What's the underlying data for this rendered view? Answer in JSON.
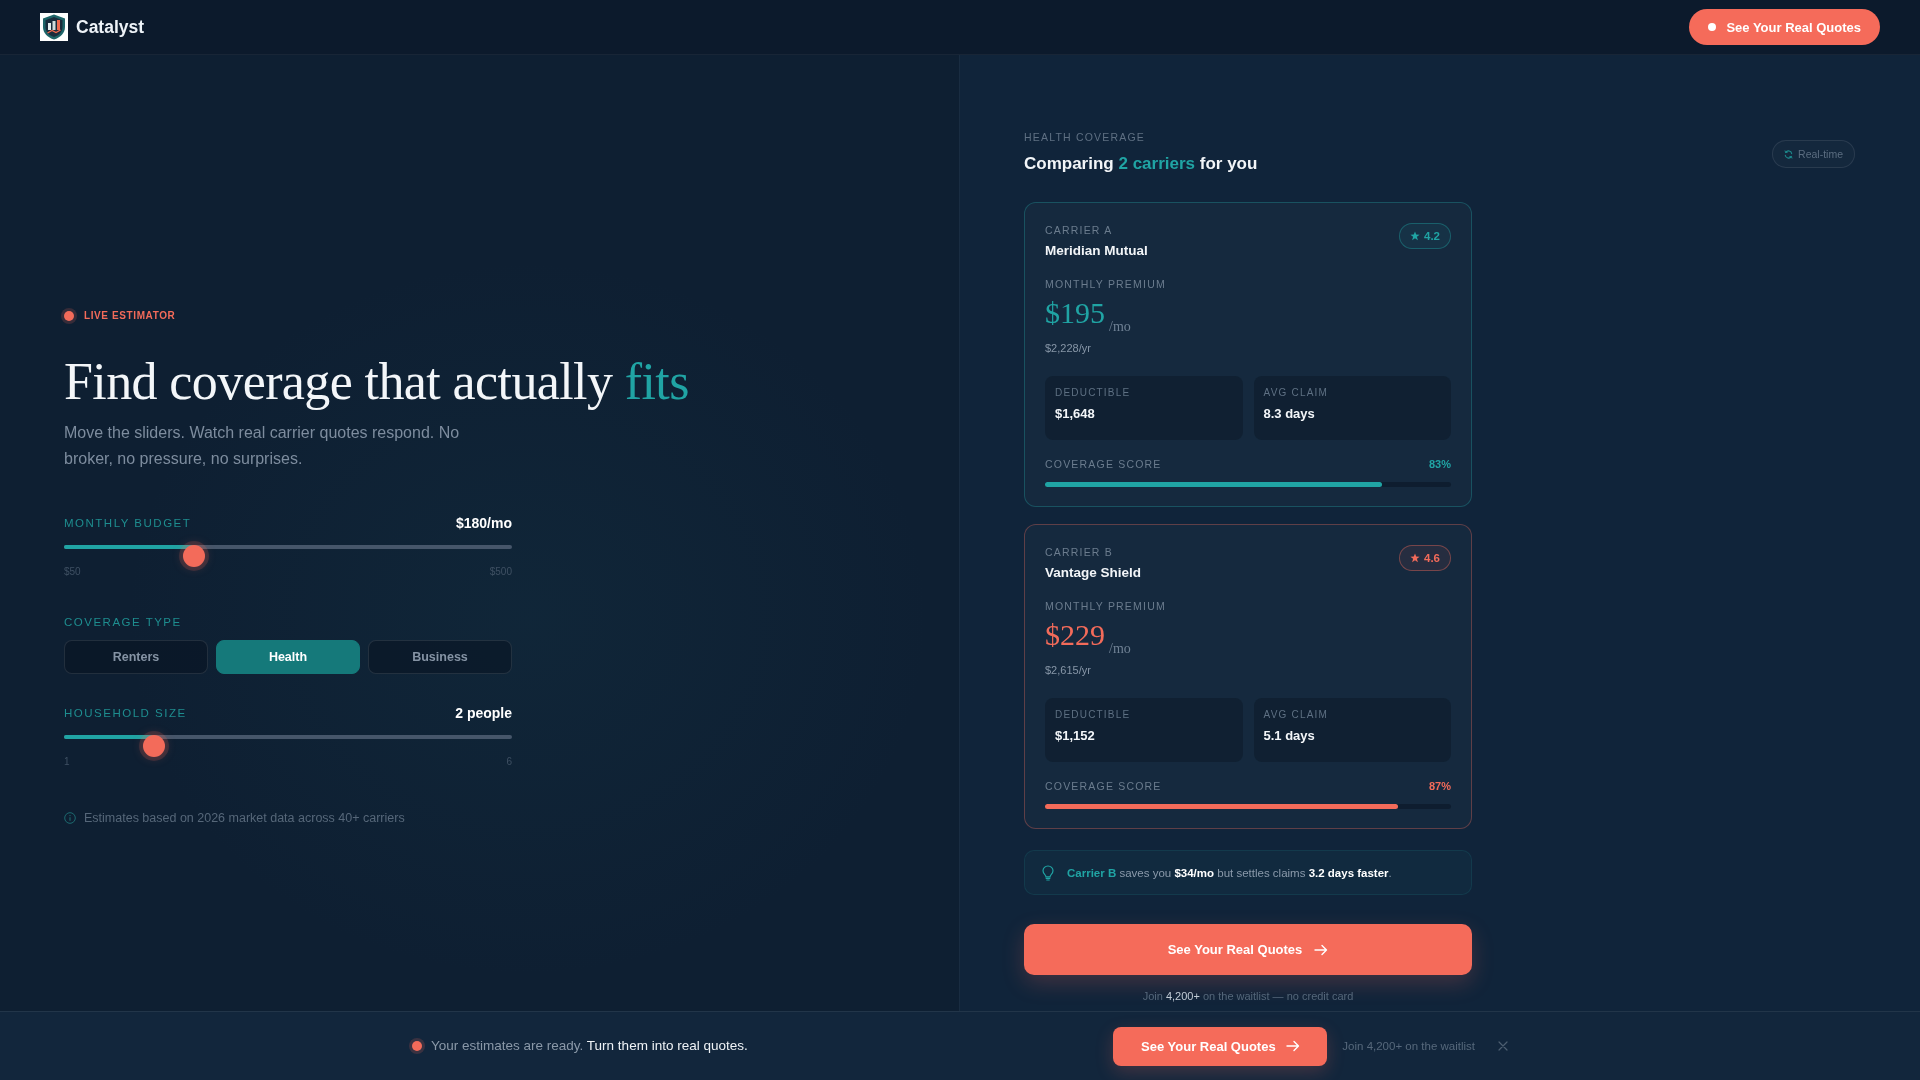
{
  "header": {
    "brand": "Catalyst",
    "cta": "See Your Real Quotes"
  },
  "estimator": {
    "eyebrow": "LIVE ESTIMATOR",
    "title": "Find coverage that actually",
    "title_accent": "fits",
    "subtitle": "Move the sliders. Watch real carrier quotes respond. No broker, no pressure, no surprises.",
    "controls": [
      {
        "kind": "slider",
        "label": "MONTHLY BUDGET",
        "value": "$180/mo",
        "level": 0.29,
        "min": "$50",
        "max": "$500"
      },
      {
        "kind": "choice",
        "label": "COVERAGE TYPE",
        "options": [
          {
            "label": "Renters",
            "selected": false
          },
          {
            "label": "Health",
            "selected": true
          },
          {
            "label": "Business",
            "selected": false
          }
        ]
      },
      {
        "kind": "slider",
        "label": "HOUSEHOLD SIZE",
        "value": "2 people",
        "level": 0.2,
        "min": "1",
        "max": "6"
      }
    ],
    "note": "Estimates based on 2026 market data across 40+ carriers"
  },
  "comparison": {
    "eyebrow": "HEALTH COVERAGE",
    "heading": {
      "lead": "Comparing",
      "accent": "2 carriers",
      "tail": "for you"
    },
    "badge": "Real-time",
    "carriers": [
      {
        "tag": "CARRIER A",
        "name": "Meridian Mutual",
        "rating": "4.2",
        "color": "#20a4a4",
        "premium_label": "MONTHLY PREMIUM",
        "price": "$195",
        "unit": "/mo",
        "yearly": "$2,228/yr",
        "stats": [
          {
            "label": "DEDUCTIBLE",
            "value": "$1,648"
          },
          {
            "label": "AVG CLAIM",
            "value": "8.3 days"
          }
        ],
        "score_label": "COVERAGE SCORE",
        "score": "83%",
        "level": 0.83
      },
      {
        "tag": "CARRIER B",
        "name": "Vantage Shield",
        "rating": "4.6",
        "color": "#f36b5a",
        "premium_label": "MONTHLY PREMIUM",
        "price": "$229",
        "unit": "/mo",
        "yearly": "$2,615/yr",
        "stats": [
          {
            "label": "DEDUCTIBLE",
            "value": "$1,152"
          },
          {
            "label": "AVG CLAIM",
            "value": "5.1 days"
          }
        ],
        "score_label": "COVERAGE SCORE",
        "score": "87%",
        "level": 0.87
      }
    ],
    "tip": {
      "subject": "Carrier B",
      "text": "saves you **$34/mo** but settles claims **3.2 days faster**."
    },
    "cta": "See Your Real Quotes",
    "waitlist": "Join **4,200+** on the waitlist — no credit card"
  },
  "bottom_bar": {
    "status": "Your estimates are ready.",
    "message": "Turn them into real quotes.",
    "cta": "See Your Real Quotes",
    "note": "Join 4,200+ on the waitlist"
  }
}
